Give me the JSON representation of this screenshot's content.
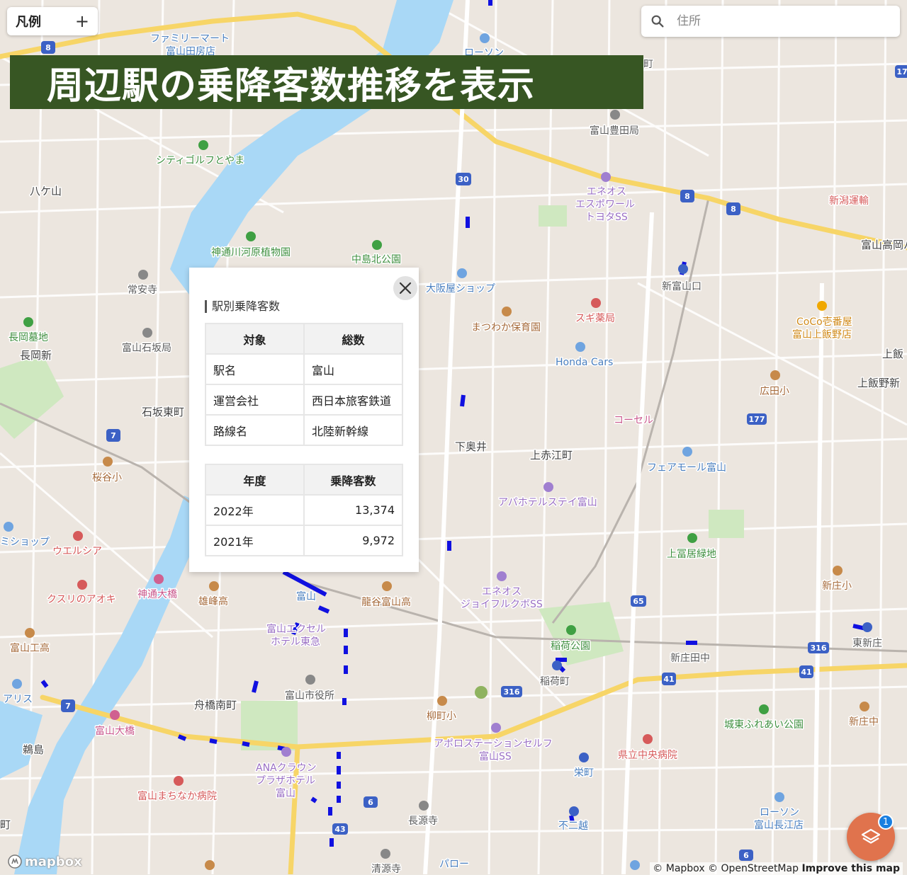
{
  "legend": {
    "title": "凡例",
    "add_symbol": "+"
  },
  "search": {
    "placeholder": "住所"
  },
  "banner": {
    "title": "周辺駅の乗降客数推移を表示"
  },
  "popup": {
    "heading": "駅別乗降客数",
    "info_header": {
      "col1": "対象",
      "col2": "総数"
    },
    "info_rows": [
      {
        "label": "駅名",
        "value": "富山"
      },
      {
        "label": "運営会社",
        "value": "西日本旅客鉄道"
      },
      {
        "label": "路線名",
        "value": "北陸新幹線"
      }
    ],
    "stats_header": {
      "col1": "年度",
      "col2": "乗降客数"
    },
    "stats_rows": [
      {
        "year": "2022年",
        "count": "13,374"
      },
      {
        "year": "2021年",
        "count": "9,972"
      }
    ]
  },
  "map_labels": {
    "familymart": "ファミリーマート",
    "toyama_tabe": "富山田房店",
    "lawson_top": "ローソン",
    "machi_top": "町",
    "toyama_toyoda_post": "富山豊田局",
    "city_golf": "シティゴルフとやま",
    "hachikesan": "八ケ山",
    "eneos_es_1": "エネオス",
    "eneos_es_2": "エスポワール",
    "eneos_es_3": "トヨタSS",
    "niigata_unyu": "新潟運輸",
    "toyama_takaoka": "富山高岡バ",
    "jinzu_park": "神通川河原植物園",
    "nakajima_park": "中島北公園",
    "joanji": "常安寺",
    "osakaya": "大阪屋ショップ",
    "shintoyamaguchi": "新富山口",
    "sugi": "スギ薬局",
    "nagaoka_cemetery": "長岡墓地",
    "nagaoka_shin": "長岡新",
    "toyama_ishizaka": "富山石坂局",
    "matsuwaka": "まつわか保育園",
    "coco_1": "CoCo壱番屋",
    "coco_2": "富山上飯野店",
    "kamiiino": "上飯",
    "kamiiinoshin": "上飯野新",
    "honda": "Honda Cars",
    "hirotasho": "広田小",
    "ishizaka_higashi": "石坂東町",
    "kosel": "コーセル",
    "shimookui": "下奥井",
    "kamiakae": "上赤江町",
    "fairmall": "フェアモール富山",
    "sakuratani": "桜谷小",
    "apa": "アパホテルステイ富山",
    "shop_left": "ミショップ",
    "uelsia": "ウエルシア",
    "kamitomii": "上冨居緑地",
    "kusuri_aoki": "クスリのアオキ",
    "jinzu_ohashi": "神通大橋",
    "yuhoko": "雄峰高",
    "toyama_station": "富山",
    "ryukoku": "龍谷富山高",
    "eneos_joy_1": "エネオス",
    "eneos_joy_2": "ジョイフルクボSS",
    "shinjo_sho": "新庄小",
    "toyama_kogyo": "富山工高",
    "excel_1": "富山エクセル",
    "excel_2": "ホテル東急",
    "inari_park": "稲荷公園",
    "shinjo_tanaka": "新庄田中",
    "higashi_shinjo": "東新庄",
    "arisu": "アリス",
    "city_hall": "富山市役所",
    "inarimachi": "稲荷町",
    "funahashi": "舟橋南町",
    "yanagimachi": "柳町小",
    "joto_park": "城東ふれあい公園",
    "shinjo_naka": "新庄中",
    "toyama_ohashi": "富山大橋",
    "apollo_1": "アポロステーションセルフ",
    "apollo_2": "富山SS",
    "kenritsu": "県立中央病院",
    "kamojima": "鵜島",
    "ana_1": "ANAクラウン",
    "ana_2": "プラザホテル",
    "ana_3": "富山",
    "sakaemachi": "栄町",
    "machinaka": "富山まちなか病院",
    "choganji": "長源寺",
    "fujikoshi": "不二越",
    "lawson_bottom_1": "ローソン",
    "lawson_bottom_2": "富山長江店",
    "machi_left": "町",
    "parlor": "パロー",
    "shimizu": "清源寺"
  },
  "route_shields": [
    "8",
    "8",
    "8",
    "8",
    "30",
    "177",
    "7",
    "7",
    "65",
    "316",
    "316",
    "41",
    "41",
    "6",
    "43",
    "17",
    "6"
  ],
  "attribution": {
    "logo": "mapbox",
    "text": "© Mapbox © OpenStreetMap",
    "improve": "Improve this map"
  },
  "layers": {
    "badge": "1"
  },
  "colors": {
    "banner_bg": "#375623",
    "station_line": "#1010e0",
    "river": "#a9d8f6",
    "road_major": "#f7d567",
    "layers_button": "#e0734d"
  }
}
